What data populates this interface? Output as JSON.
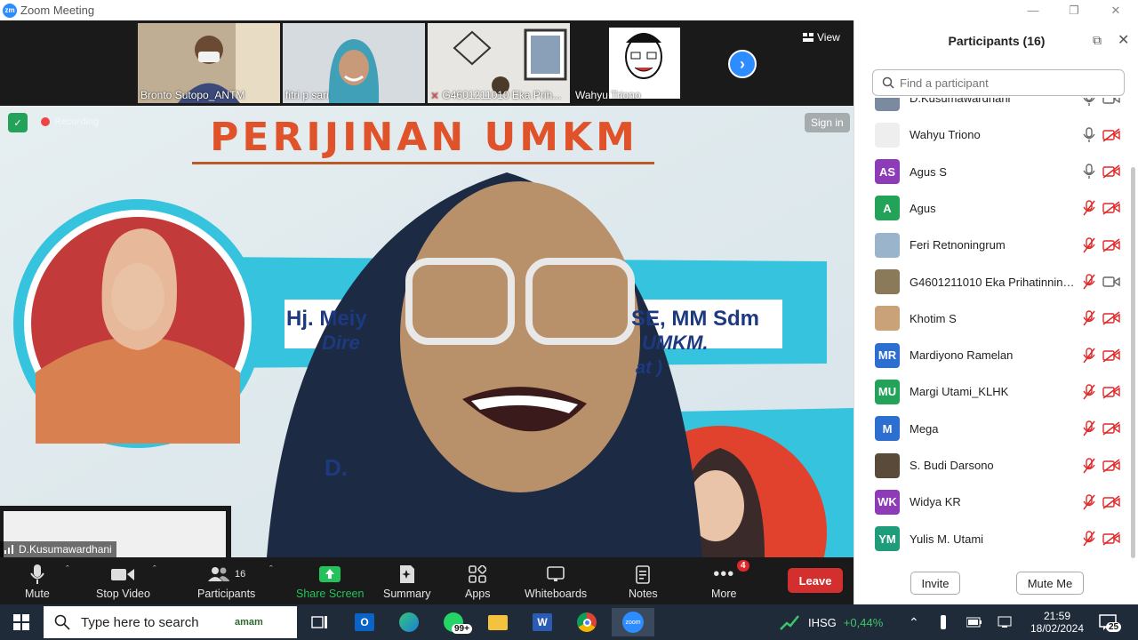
{
  "window": {
    "title": "Zoom Meeting"
  },
  "thumbnails": [
    {
      "name": "Bronto Sutopo_ANTM"
    },
    {
      "name": "fitri p sari"
    },
    {
      "name": "G4601211010 Eka Prih..."
    },
    {
      "name": "Wahyu Triono"
    }
  ],
  "view_label": "View",
  "main": {
    "recording_label": "Recording",
    "signin_label": "Sign in",
    "speaker_name": "D.Kusumawardhani",
    "slide": {
      "title": "PERIJINAN UMKM",
      "line1": "Hj. Meiy",
      "line1b": "SE, MM Sdm",
      "line2": "Dire",
      "line2b": "UMKM.",
      "line3": "at )",
      "line4": "D."
    }
  },
  "toolbar": {
    "mute": "Mute",
    "stop_video": "Stop Video",
    "participants": "Participants",
    "participants_count": "16",
    "share_screen": "Share Screen",
    "summary": "Summary",
    "apps": "Apps",
    "whiteboards": "Whiteboards",
    "notes": "Notes",
    "more": "More",
    "more_badge": "4",
    "leave": "Leave"
  },
  "panel": {
    "title": "Participants (16)",
    "search_placeholder": "Find a participant",
    "invite": "Invite",
    "mute_me": "Mute Me",
    "participants": [
      {
        "name": "D.Kusumawardhani",
        "initials": "",
        "color": "#7a8aa0",
        "mic": "on",
        "cam": "on"
      },
      {
        "name": "Wahyu Triono",
        "initials": "",
        "color": "#eeeeee",
        "mic": "on",
        "cam": "off"
      },
      {
        "name": "Agus S",
        "initials": "AS",
        "color": "#8e3bb8",
        "mic": "on",
        "cam": "off"
      },
      {
        "name": "Agus",
        "initials": "A",
        "color": "#23a35a",
        "mic": "muted",
        "cam": "off"
      },
      {
        "name": "Feri Retnoningrum",
        "initials": "",
        "color": "#9ab4cc",
        "mic": "muted",
        "cam": "off"
      },
      {
        "name": "G4601211010 Eka Prihatinning...",
        "initials": "",
        "color": "#8a7a5a",
        "mic": "muted",
        "cam": "on"
      },
      {
        "name": "Khotim S",
        "initials": "",
        "color": "#c9a27a",
        "mic": "muted",
        "cam": "off"
      },
      {
        "name": "Mardiyono Ramelan",
        "initials": "MR",
        "color": "#2d6fd1",
        "mic": "muted",
        "cam": "off"
      },
      {
        "name": "Margi Utami_KLHK",
        "initials": "MU",
        "color": "#23a35a",
        "mic": "muted",
        "cam": "off"
      },
      {
        "name": "Mega",
        "initials": "M",
        "color": "#2d6fd1",
        "mic": "muted",
        "cam": "off"
      },
      {
        "name": "S. Budi Darsono",
        "initials": "",
        "color": "#5a4a3a",
        "mic": "muted",
        "cam": "off"
      },
      {
        "name": "Widya KR",
        "initials": "WK",
        "color": "#8e3bb8",
        "mic": "muted",
        "cam": "off"
      },
      {
        "name": "Yulis M. Utami",
        "initials": "YM",
        "color": "#1f9d7a",
        "mic": "muted",
        "cam": "off"
      }
    ]
  },
  "taskbar": {
    "search_placeholder": "Type here to search",
    "widget_label": "amam",
    "whatsapp_badge": "99+",
    "stock_label": "IHSG",
    "stock_change": "+0,44%",
    "time": "21:59",
    "date": "18/02/2024",
    "notif_count": "25"
  },
  "colors": {
    "accent": "#2d8cff",
    "share": "#23c25a",
    "leave": "#d32f2f",
    "muted_red": "#e02828"
  }
}
